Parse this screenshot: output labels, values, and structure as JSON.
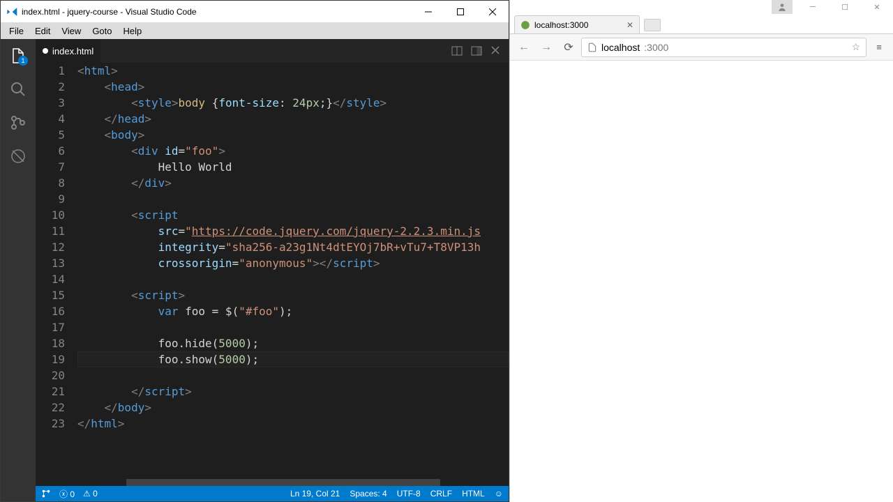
{
  "vscode": {
    "title": "index.html - jquery-course - Visual Studio Code",
    "menus": [
      "File",
      "Edit",
      "View",
      "Goto",
      "Help"
    ],
    "tab": {
      "name": "index.html",
      "dirty": true
    },
    "activity_badge": "1",
    "status": {
      "errors": "0",
      "warnings": "0",
      "position": "Ln 19, Col 21",
      "spaces": "Spaces: 4",
      "encoding": "UTF-8",
      "eol": "CRLF",
      "language": "HTML"
    },
    "code": {
      "lines": [
        {
          "n": 1,
          "ind": 0,
          "seg": [
            [
              "bracket",
              "<"
            ],
            [
              "tag",
              "html"
            ],
            [
              "bracket",
              ">"
            ]
          ]
        },
        {
          "n": 2,
          "ind": 1,
          "seg": [
            [
              "bracket",
              "<"
            ],
            [
              "tag",
              "head"
            ],
            [
              "bracket",
              ">"
            ]
          ]
        },
        {
          "n": 3,
          "ind": 2,
          "seg": [
            [
              "bracket",
              "<"
            ],
            [
              "tag",
              "style"
            ],
            [
              "bracket",
              ">"
            ],
            [
              "sel",
              "body "
            ],
            [
              "text",
              "{"
            ],
            [
              "attr",
              "font-size"
            ],
            [
              "text",
              ": "
            ],
            [
              "num",
              "24px"
            ],
            [
              "text",
              ";}"
            ],
            [
              "bracket",
              "</"
            ],
            [
              "tag",
              "style"
            ],
            [
              "bracket",
              ">"
            ]
          ]
        },
        {
          "n": 4,
          "ind": 1,
          "seg": [
            [
              "bracket",
              "</"
            ],
            [
              "tag",
              "head"
            ],
            [
              "bracket",
              ">"
            ]
          ]
        },
        {
          "n": 5,
          "ind": 1,
          "seg": [
            [
              "bracket",
              "<"
            ],
            [
              "tag",
              "body"
            ],
            [
              "bracket",
              ">"
            ]
          ]
        },
        {
          "n": 6,
          "ind": 2,
          "seg": [
            [
              "bracket",
              "<"
            ],
            [
              "tag",
              "div"
            ],
            [
              "text",
              " "
            ],
            [
              "attr",
              "id"
            ],
            [
              "text",
              "="
            ],
            [
              "string",
              "\"foo\""
            ],
            [
              "bracket",
              ">"
            ]
          ]
        },
        {
          "n": 7,
          "ind": 3,
          "seg": [
            [
              "text",
              "Hello World"
            ]
          ]
        },
        {
          "n": 8,
          "ind": 2,
          "seg": [
            [
              "bracket",
              "</"
            ],
            [
              "tag",
              "div"
            ],
            [
              "bracket",
              ">"
            ]
          ]
        },
        {
          "n": 9,
          "ind": 0,
          "seg": []
        },
        {
          "n": 10,
          "ind": 2,
          "seg": [
            [
              "bracket",
              "<"
            ],
            [
              "tag",
              "script"
            ]
          ]
        },
        {
          "n": 11,
          "ind": 3,
          "seg": [
            [
              "attr",
              "src"
            ],
            [
              "text",
              "="
            ],
            [
              "string",
              "\""
            ],
            [
              "url",
              "https://code.jquery.com/jquery-2.2.3.min.js"
            ]
          ]
        },
        {
          "n": 12,
          "ind": 3,
          "seg": [
            [
              "attr",
              "integrity"
            ],
            [
              "text",
              "="
            ],
            [
              "string",
              "\"sha256-a23g1Nt4dtEYOj7bR+vTu7+T8VP13h"
            ]
          ]
        },
        {
          "n": 13,
          "ind": 3,
          "seg": [
            [
              "attr",
              "crossorigin"
            ],
            [
              "text",
              "="
            ],
            [
              "string",
              "\"anonymous\""
            ],
            [
              "bracket",
              "></"
            ],
            [
              "tag",
              "script"
            ],
            [
              "bracket",
              ">"
            ]
          ]
        },
        {
          "n": 14,
          "ind": 0,
          "seg": []
        },
        {
          "n": 15,
          "ind": 2,
          "seg": [
            [
              "bracket",
              "<"
            ],
            [
              "tag",
              "script"
            ],
            [
              "bracket",
              ">"
            ]
          ]
        },
        {
          "n": 16,
          "ind": 3,
          "seg": [
            [
              "keyword",
              "var"
            ],
            [
              "text",
              " foo = $("
            ],
            [
              "string",
              "\"#foo\""
            ],
            [
              "text",
              ");"
            ]
          ]
        },
        {
          "n": 17,
          "ind": 0,
          "seg": []
        },
        {
          "n": 18,
          "ind": 3,
          "seg": [
            [
              "text",
              "foo.hide("
            ],
            [
              "num",
              "5000"
            ],
            [
              "text",
              ");"
            ]
          ]
        },
        {
          "n": 19,
          "ind": 3,
          "seg": [
            [
              "text",
              "foo.show("
            ],
            [
              "num",
              "5000"
            ],
            [
              "text",
              ");"
            ]
          ],
          "current": true
        },
        {
          "n": 20,
          "ind": 0,
          "seg": []
        },
        {
          "n": 21,
          "ind": 2,
          "seg": [
            [
              "bracket",
              "</"
            ],
            [
              "tag",
              "script"
            ],
            [
              "bracket",
              ">"
            ]
          ]
        },
        {
          "n": 22,
          "ind": 1,
          "seg": [
            [
              "bracket",
              "</"
            ],
            [
              "tag",
              "body"
            ],
            [
              "bracket",
              ">"
            ]
          ]
        },
        {
          "n": 23,
          "ind": 0,
          "seg": [
            [
              "bracket",
              "</"
            ],
            [
              "tag",
              "html"
            ],
            [
              "bracket",
              ">"
            ]
          ]
        }
      ]
    }
  },
  "browser": {
    "tab_title": "localhost:3000",
    "url_host": "localhost",
    "url_path": ":3000"
  }
}
